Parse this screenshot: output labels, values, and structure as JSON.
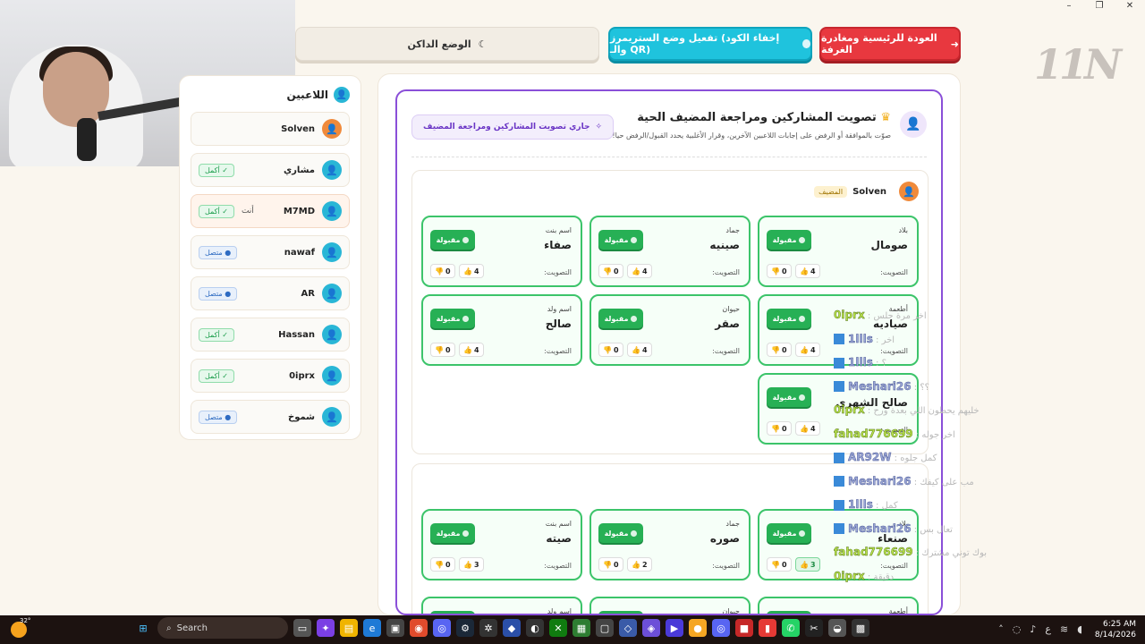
{
  "window": {
    "minimize": "–",
    "restore": "❐",
    "close": "✕"
  },
  "brand": {
    "logo": "11N"
  },
  "top_buttons": {
    "exit_label": "العودة للرئيسية ومغادرة الغرفة",
    "streamer_label": "تفعيل وضع الستريمرز (إخفاء الكود والـ QR)",
    "dark_mode_label": "الوضع الداكن"
  },
  "players": {
    "title": "اللاعبين",
    "items": [
      {
        "name": "Solven",
        "status": "",
        "host": true
      },
      {
        "name": "مشاري",
        "status": "أكمل",
        "host": false
      },
      {
        "name": "M7MD",
        "status": "أكمل",
        "you": "أنت",
        "host": false
      },
      {
        "name": "nawaf",
        "status": "متصل",
        "host": false
      },
      {
        "name": "AR",
        "status": "متصل",
        "host": false
      },
      {
        "name": "Hassan",
        "status": "أكمل",
        "host": false
      },
      {
        "name": "0iprx",
        "status": "أكمل",
        "host": false
      },
      {
        "name": "شموخ",
        "status": "متصل",
        "host": false
      }
    ]
  },
  "voting": {
    "title": "تصويت المشاركين ومراجعة المضيف الحية",
    "subtitle": "صوّت بالموافقة أو الرفض على إجابات اللاعبين الآخرين، وقرار الأغلبية يحدد القبول/الرفض حيا!",
    "pill": "جاري تصويت المشاركين ومراجعة المضيف",
    "accepted_label": "مقبولة",
    "vote_label": "التصويت:"
  },
  "host_block": {
    "name": "Solven",
    "tag": "المضيف",
    "answers": [
      {
        "category": "بلاد",
        "word": "صومال",
        "up": "4",
        "down": "0"
      },
      {
        "category": "جماد",
        "word": "صينيه",
        "up": "4",
        "down": "0"
      },
      {
        "category": "اسم بنت",
        "word": "صفاء",
        "up": "4",
        "down": "0"
      },
      {
        "category": "أطعمة",
        "word": "صياديه",
        "up": "4",
        "down": "0"
      },
      {
        "category": "حيوان",
        "word": "صقر",
        "up": "4",
        "down": "0"
      },
      {
        "category": "اسم ولد",
        "word": "صالح",
        "up": "4",
        "down": "0"
      },
      {
        "category": "",
        "word": "صالح الشهري",
        "up": "4",
        "down": "0"
      }
    ]
  },
  "second_block": {
    "answers": [
      {
        "category": "بلاد",
        "word": "صنعاء",
        "up": "3",
        "down": "0"
      },
      {
        "category": "جماد",
        "word": "صوره",
        "up": "2",
        "down": "0"
      },
      {
        "category": "اسم بنت",
        "word": "صيته",
        "up": "3",
        "down": "0"
      },
      {
        "category": "أطعمة",
        "word": "",
        "up": "",
        "down": ""
      },
      {
        "category": "حيوان",
        "word": "",
        "up": "",
        "down": ""
      },
      {
        "category": "اسم ولد",
        "word": "",
        "up": "",
        "down": ""
      }
    ]
  },
  "chat": [
    {
      "user": "0iprx",
      "msg": "اخر مرة جلس",
      "tw": false,
      "color": "u2"
    },
    {
      "user": "1llls",
      "msg": "اخر",
      "tw": true,
      "color": "u1"
    },
    {
      "user": "1llls",
      "msg": "؟",
      "tw": true,
      "color": "u1"
    },
    {
      "user": "Meshari26",
      "msg": "؟؟",
      "tw": true,
      "color": "u1"
    },
    {
      "user": "0iprx",
      "msg": "خليهم يحطون اللي بعدة ورح",
      "tw": false,
      "color": "u2"
    },
    {
      "user": "fahad776699",
      "msg": "اخر جوله",
      "tw": false,
      "color": "u2"
    },
    {
      "user": "AR92W",
      "msg": "كمل جلوه",
      "tw": true,
      "color": "u1"
    },
    {
      "user": "Meshari26",
      "msg": "مب على كيفك",
      "tw": true,
      "color": "u1"
    },
    {
      "user": "1llls",
      "msg": "كمل",
      "tw": true,
      "color": "u1"
    },
    {
      "user": "Meshari26",
      "msg": "تعال بس",
      "tw": true,
      "color": "u1"
    },
    {
      "user": "fahad776699",
      "msg": "بوك توني مشترك",
      "tw": false,
      "color": "u2"
    },
    {
      "user": "0iprx",
      "msg": "دقيقة",
      "tw": false,
      "color": "u2"
    }
  ],
  "taskbar": {
    "weather_temp": "32°",
    "search_label": "Search",
    "time": "6:25 AM",
    "date": "8/14/2026",
    "lang": "ع"
  }
}
